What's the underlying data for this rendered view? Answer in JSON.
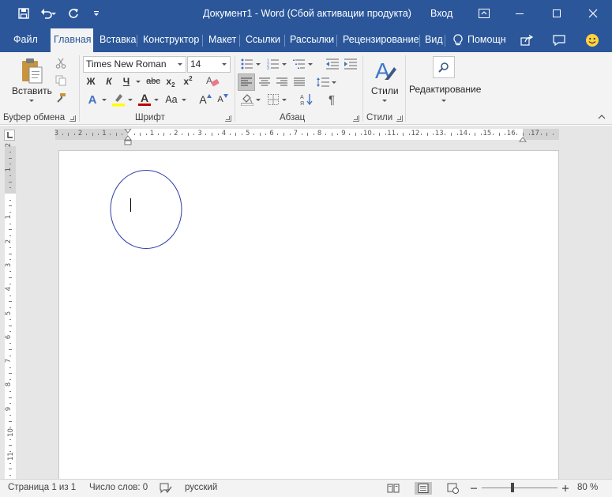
{
  "window": {
    "title": "Документ1  -  Word (Сбой активации продукта)",
    "login": "Вход"
  },
  "tabs": [
    {
      "label": "Файл"
    },
    {
      "label": "Главная"
    },
    {
      "label": "Вставка"
    },
    {
      "label": "Конструктор"
    },
    {
      "label": "Макет"
    },
    {
      "label": "Ссылки"
    },
    {
      "label": "Рассылки"
    },
    {
      "label": "Рецензирование"
    },
    {
      "label": "Вид"
    },
    {
      "label": "Помощн"
    }
  ],
  "ribbon": {
    "clipboard": {
      "paste_label": "Вставить",
      "group_label": "Буфер обмена"
    },
    "font": {
      "font_name": "Times New Roman",
      "font_size": "14",
      "bold": "Ж",
      "italic": "К",
      "underline": "Ч",
      "strike": "abc",
      "subscript": "x",
      "subscript_mark": "2",
      "superscript": "x",
      "superscript_mark": "2",
      "text_effects": "A",
      "font_color": "A",
      "change_case": "Aa",
      "grow_font": "A",
      "shrink_font": "A",
      "group_label": "Шрифт",
      "highlight_color": "#ffff00",
      "font_color_value": "#c00000"
    },
    "paragraph": {
      "group_label": "Абзац",
      "pilcrow": "¶"
    },
    "styles": {
      "label": "Стили",
      "group_label": "Стили"
    },
    "editing": {
      "label": "Редактирование"
    }
  },
  "ruler": {
    "h_numbers": [
      "3",
      "2",
      "1",
      "1",
      "2",
      "3",
      "4",
      "5",
      "6",
      "7",
      "8",
      "9",
      "10",
      "11",
      "12",
      "13",
      "14",
      "15",
      "16",
      "17"
    ],
    "v_numbers": [
      "2",
      "1",
      "1",
      "2",
      "3",
      "4",
      "5",
      "6",
      "7",
      "8",
      "9",
      "10",
      "11"
    ]
  },
  "status": {
    "page": "Страница 1 из 1",
    "words": "Число слов: 0",
    "language": "русский",
    "zoom": "80 %"
  },
  "colors": {
    "accent": "#2b579a",
    "shape_outline": "#2e3ea8"
  }
}
